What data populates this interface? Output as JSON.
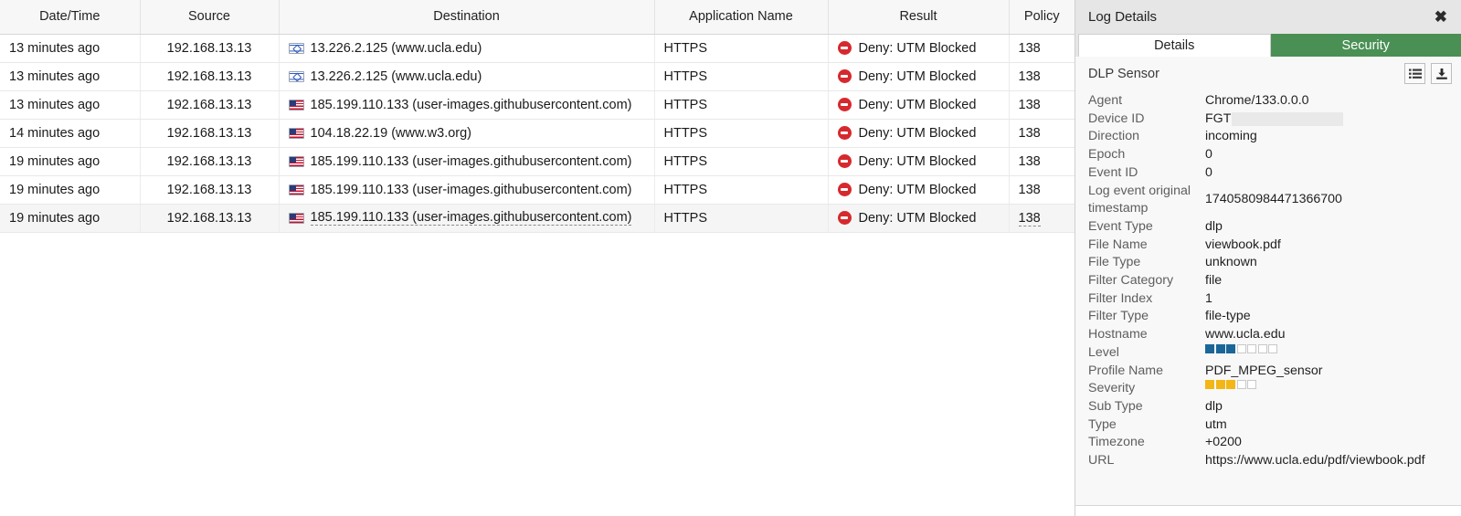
{
  "table": {
    "columns": [
      "Date/Time",
      "Source",
      "Destination",
      "Application Name",
      "Result",
      "Policy"
    ],
    "rows": [
      {
        "date": "13 minutes ago",
        "source": "192.168.13.13",
        "flag": "il-flag-icon",
        "destination": "13.226.2.125 (www.ucla.edu)",
        "app": "HTTPS",
        "result": "Deny: UTM Blocked",
        "policy": "138"
      },
      {
        "date": "13 minutes ago",
        "source": "192.168.13.13",
        "flag": "il-flag-icon",
        "destination": "13.226.2.125 (www.ucla.edu)",
        "app": "HTTPS",
        "result": "Deny: UTM Blocked",
        "policy": "138"
      },
      {
        "date": "13 minutes ago",
        "source": "192.168.13.13",
        "flag": "us-flag-icon",
        "destination": "185.199.110.133 (user-images.githubusercontent.com)",
        "app": "HTTPS",
        "result": "Deny: UTM Blocked",
        "policy": "138"
      },
      {
        "date": "14 minutes ago",
        "source": "192.168.13.13",
        "flag": "us-flag-icon",
        "destination": "104.18.22.19 (www.w3.org)",
        "app": "HTTPS",
        "result": "Deny: UTM Blocked",
        "policy": "138"
      },
      {
        "date": "19 minutes ago",
        "source": "192.168.13.13",
        "flag": "us-flag-icon",
        "destination": "185.199.110.133 (user-images.githubusercontent.com)",
        "app": "HTTPS",
        "result": "Deny: UTM Blocked",
        "policy": "138"
      },
      {
        "date": "19 minutes ago",
        "source": "192.168.13.13",
        "flag": "us-flag-icon",
        "destination": "185.199.110.133 (user-images.githubusercontent.com)",
        "app": "HTTPS",
        "result": "Deny: UTM Blocked",
        "policy": "138"
      },
      {
        "date": "19 minutes ago",
        "source": "192.168.13.13",
        "flag": "us-flag-icon",
        "destination": "185.199.110.133 (user-images.githubusercontent.com)",
        "app": "HTTPS",
        "result": "Deny: UTM Blocked",
        "policy": "138",
        "hovered": true
      }
    ]
  },
  "panel": {
    "title": "Log Details",
    "close_icon": "close-icon",
    "tabs": [
      {
        "label": "Details",
        "active": false
      },
      {
        "label": "Security",
        "active": true
      }
    ],
    "section": {
      "title": "DLP Sensor",
      "list_icon": "list-view-icon",
      "download_icon": "download-icon"
    },
    "fields": [
      {
        "key": "Agent",
        "value": "Chrome/133.0.0.0"
      },
      {
        "key": "Device ID",
        "value": "FGT",
        "redacted": true
      },
      {
        "key": "Direction",
        "value": "incoming"
      },
      {
        "key": "Epoch",
        "value": "0"
      },
      {
        "key": "Event ID",
        "value": "0"
      },
      {
        "key": "Log event original timestamp",
        "value": "1740580984471366700",
        "wrap": true
      },
      {
        "key": "Event Type",
        "value": "dlp"
      },
      {
        "key": "File Name",
        "value": "viewbook.pdf"
      },
      {
        "key": "File Type",
        "value": "unknown"
      },
      {
        "key": "Filter Category",
        "value": "file"
      },
      {
        "key": "Filter Index",
        "value": "1"
      },
      {
        "key": "Filter Type",
        "value": "file-type"
      },
      {
        "key": "Hostname",
        "value": "www.ucla.edu"
      },
      {
        "key": "Level",
        "meter": {
          "filled": 3,
          "total": 7,
          "color": "blue"
        }
      },
      {
        "key": "Profile Name",
        "value": "PDF_MPEG_sensor"
      },
      {
        "key": "Severity",
        "meter": {
          "filled": 3,
          "total": 5,
          "color": "yellow"
        }
      },
      {
        "key": "Sub Type",
        "value": "dlp"
      },
      {
        "key": "Type",
        "value": "utm"
      },
      {
        "key": "Timezone",
        "value": "+0200"
      },
      {
        "key": "URL",
        "value": "https://www.ucla.edu/pdf/viewbook.pdf"
      }
    ]
  },
  "colors": {
    "accent_green": "#4a9055",
    "deny_red": "#d6292e",
    "level_blue": "#1b6699",
    "severity_yellow": "#f2b616"
  }
}
